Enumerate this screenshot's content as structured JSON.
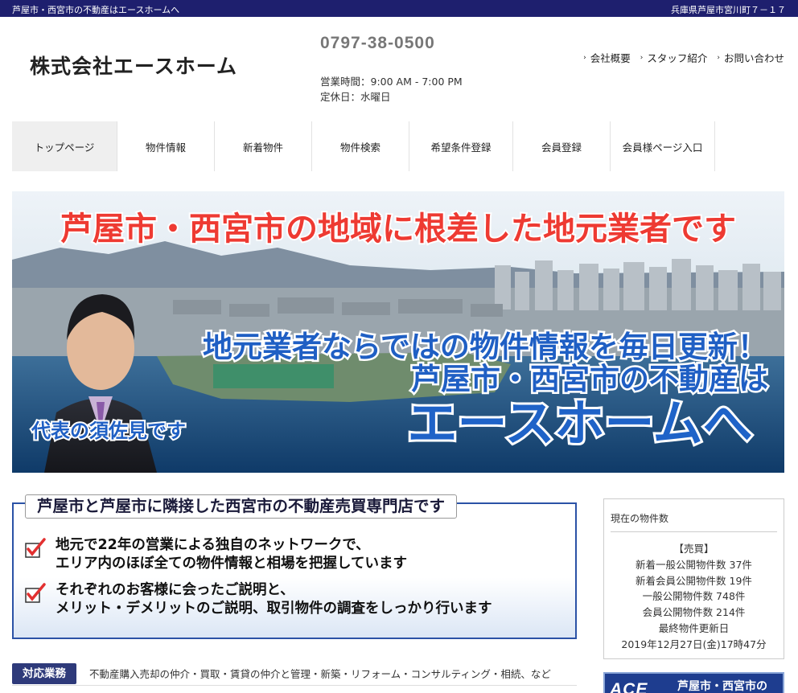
{
  "topbar": {
    "left_text": "芦屋市・西宮市の不動産はエースホームへ",
    "right_text": "兵庫県芦屋市宮川町７－１７"
  },
  "header": {
    "logo_text": "株式会社エースホーム",
    "phone": "0797-38-0500",
    "hours": "営業時間：9:00 AM - 7:00 PM",
    "closed": "定休日：水曜日",
    "links": [
      "会社概要",
      "スタッフ紹介",
      "お問い合わせ"
    ]
  },
  "nav": {
    "items": [
      "トップページ",
      "物件情報",
      "新着物件",
      "物件検索",
      "希望条件登録",
      "会員登録",
      "会員様ページ入口"
    ],
    "active": "トップページ"
  },
  "hero": {
    "headline": "芦屋市・西宮市の地域に根差した地元業者です",
    "line1": "地元業者ならではの物件情報を毎日更新！",
    "line2": "芦屋市・西宮市の不動産は",
    "line3": "エースホームへ",
    "caption": "代表の須佐見です"
  },
  "feature": {
    "heading": "芦屋市と芦屋市に隣接した西宮市の不動産売買専門店です",
    "points": [
      {
        "line1": "地元で22年の営業による独自のネットワークで、",
        "line2": "エリア内のほぼ全ての物件情報と相場を把握しています"
      },
      {
        "line1": "それぞれのお客様に会ったご説明と、",
        "line2": "メリット・デメリットのご説明、取引物件の調査をしっかり行います"
      }
    ]
  },
  "business": {
    "tag": "対応業務",
    "text": "不動産購入売却の仲介・買取・賃貸の仲介と管理・新築・リフォーム・コンサルティング・相続、など"
  },
  "sidebar": {
    "title": "現在の物件数",
    "lines": [
      "【売買】",
      "新着一般公開物件数 37件",
      "新着会員公開物件数 19件",
      "一般公開物件数 748件",
      "会員公開物件数 214件",
      "最終物件更新日",
      "2019年12月27日(金)17時47分"
    ],
    "banner_logo": "ACE",
    "banner_text": "芦屋市・西宮市の"
  },
  "colors": {
    "topbar": "#1e1f6e",
    "accent_blue": "#2b52a6",
    "hero_red_text": "#d9322d",
    "hero_blue_text": "#1f63c8"
  }
}
